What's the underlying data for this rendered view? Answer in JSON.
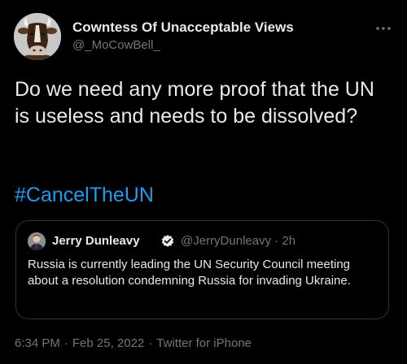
{
  "author": {
    "display_name": "Cowntess Of Unacceptable Views",
    "handle": "@_MoCowBell_",
    "avatar_icon": "cow-avatar"
  },
  "more_icon": "more-horizontal-icon",
  "tweet": {
    "text": "Do we need any more proof that the UN is useless and needs to be dissolved?",
    "hashtag": "#CancelTheUN"
  },
  "quoted_tweet": {
    "display_name": "Jerry Dunleavy",
    "verified_icon": "verified-badge-icon",
    "handle_time": "@JerryDunleavy · 2h",
    "text": "Russia is currently leading the UN Security Council meeting about a resolution condemning Russia for invading Ukraine."
  },
  "footer": {
    "time": "6:34 PM",
    "separator": "·",
    "date": "Feb 25, 2022",
    "source": "Twitter for iPhone"
  },
  "colors": {
    "background": "#000000",
    "text": "#e7e9ea",
    "secondary_text": "#71767b",
    "link": "#1d9bf0",
    "border": "#2f3336"
  }
}
